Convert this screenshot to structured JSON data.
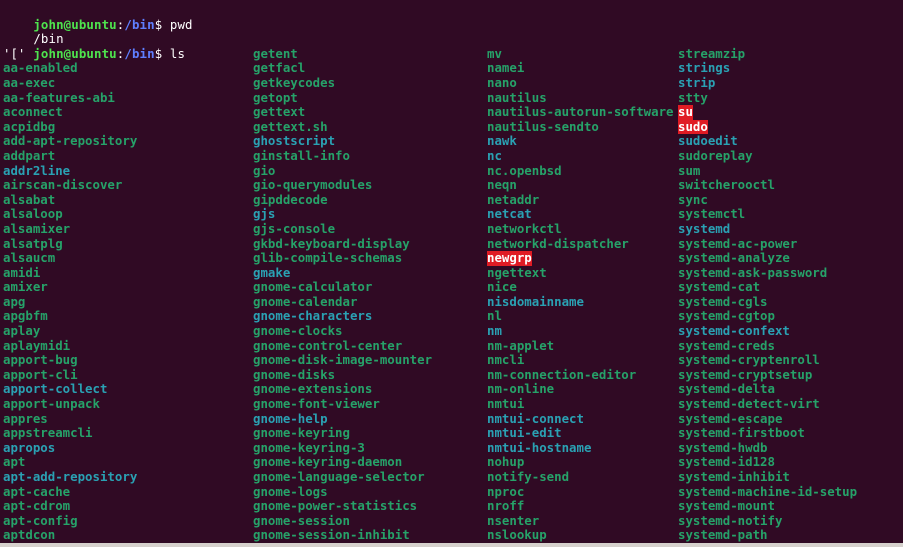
{
  "terminal": {
    "theme": {
      "background": "#300a24",
      "foreground": "#ffffff",
      "exec_color": "#26a269",
      "link_color": "#2aa1b3",
      "setuid_bg": "#e01b24",
      "prompt_user_color": "#4ee44e",
      "prompt_path_color": "#5f7fff"
    },
    "prompt": {
      "user_host": "john@ubuntu",
      "colon": ":",
      "path": "/bin",
      "sigil": "$"
    },
    "history": [
      {
        "type": "prompt",
        "command": " pwd"
      },
      {
        "type": "output",
        "text": "/bin"
      },
      {
        "type": "prompt",
        "command": " ls"
      }
    ],
    "ls": {
      "columns": 4,
      "rows": 34,
      "entries": [
        [
          {
            "name": "'['",
            "style": "plain"
          },
          {
            "name": "getent",
            "style": "exec"
          },
          {
            "name": "mv",
            "style": "exec"
          },
          {
            "name": "streamzip",
            "style": "exec"
          }
        ],
        [
          {
            "name": "aa-enabled",
            "style": "exec"
          },
          {
            "name": "getfacl",
            "style": "exec"
          },
          {
            "name": "namei",
            "style": "exec"
          },
          {
            "name": "strings",
            "style": "link"
          }
        ],
        [
          {
            "name": "aa-exec",
            "style": "exec"
          },
          {
            "name": "getkeycodes",
            "style": "exec"
          },
          {
            "name": "nano",
            "style": "exec"
          },
          {
            "name": "strip",
            "style": "link"
          }
        ],
        [
          {
            "name": "aa-features-abi",
            "style": "exec"
          },
          {
            "name": "getopt",
            "style": "exec"
          },
          {
            "name": "nautilus",
            "style": "exec"
          },
          {
            "name": "stty",
            "style": "exec"
          }
        ],
        [
          {
            "name": "aconnect",
            "style": "exec"
          },
          {
            "name": "gettext",
            "style": "exec"
          },
          {
            "name": "nautilus-autorun-software",
            "style": "exec"
          },
          {
            "name": "su",
            "style": "setuid"
          }
        ],
        [
          {
            "name": "acpidbg",
            "style": "exec"
          },
          {
            "name": "gettext.sh",
            "style": "exec"
          },
          {
            "name": "nautilus-sendto",
            "style": "exec"
          },
          {
            "name": "sudo",
            "style": "setuid"
          }
        ],
        [
          {
            "name": "add-apt-repository",
            "style": "exec"
          },
          {
            "name": "ghostscript",
            "style": "link"
          },
          {
            "name": "nawk",
            "style": "link"
          },
          {
            "name": "sudoedit",
            "style": "link"
          }
        ],
        [
          {
            "name": "addpart",
            "style": "exec"
          },
          {
            "name": "ginstall-info",
            "style": "exec"
          },
          {
            "name": "nc",
            "style": "link"
          },
          {
            "name": "sudoreplay",
            "style": "exec"
          }
        ],
        [
          {
            "name": "addr2line",
            "style": "link"
          },
          {
            "name": "gio",
            "style": "exec"
          },
          {
            "name": "nc.openbsd",
            "style": "exec"
          },
          {
            "name": "sum",
            "style": "exec"
          }
        ],
        [
          {
            "name": "airscan-discover",
            "style": "exec"
          },
          {
            "name": "gio-querymodules",
            "style": "exec"
          },
          {
            "name": "neqn",
            "style": "exec"
          },
          {
            "name": "switcherooctl",
            "style": "exec"
          }
        ],
        [
          {
            "name": "alsabat",
            "style": "exec"
          },
          {
            "name": "gipddecode",
            "style": "exec"
          },
          {
            "name": "netaddr",
            "style": "exec"
          },
          {
            "name": "sync",
            "style": "exec"
          }
        ],
        [
          {
            "name": "alsaloop",
            "style": "exec"
          },
          {
            "name": "gjs",
            "style": "link"
          },
          {
            "name": "netcat",
            "style": "link"
          },
          {
            "name": "systemctl",
            "style": "exec"
          }
        ],
        [
          {
            "name": "alsamixer",
            "style": "exec"
          },
          {
            "name": "gjs-console",
            "style": "exec"
          },
          {
            "name": "networkctl",
            "style": "exec"
          },
          {
            "name": "systemd",
            "style": "link"
          }
        ],
        [
          {
            "name": "alsatplg",
            "style": "exec"
          },
          {
            "name": "gkbd-keyboard-display",
            "style": "exec"
          },
          {
            "name": "networkd-dispatcher",
            "style": "exec"
          },
          {
            "name": "systemd-ac-power",
            "style": "exec"
          }
        ],
        [
          {
            "name": "alsaucm",
            "style": "exec"
          },
          {
            "name": "glib-compile-schemas",
            "style": "exec"
          },
          {
            "name": "newgrp",
            "style": "setuid"
          },
          {
            "name": "systemd-analyze",
            "style": "exec"
          }
        ],
        [
          {
            "name": "amidi",
            "style": "exec"
          },
          {
            "name": "gmake",
            "style": "link"
          },
          {
            "name": "ngettext",
            "style": "exec"
          },
          {
            "name": "systemd-ask-password",
            "style": "exec"
          }
        ],
        [
          {
            "name": "amixer",
            "style": "exec"
          },
          {
            "name": "gnome-calculator",
            "style": "exec"
          },
          {
            "name": "nice",
            "style": "exec"
          },
          {
            "name": "systemd-cat",
            "style": "exec"
          }
        ],
        [
          {
            "name": "apg",
            "style": "exec"
          },
          {
            "name": "gnome-calendar",
            "style": "exec"
          },
          {
            "name": "nisdomainname",
            "style": "link"
          },
          {
            "name": "systemd-cgls",
            "style": "exec"
          }
        ],
        [
          {
            "name": "apgbfm",
            "style": "exec"
          },
          {
            "name": "gnome-characters",
            "style": "link"
          },
          {
            "name": "nl",
            "style": "exec"
          },
          {
            "name": "systemd-cgtop",
            "style": "exec"
          }
        ],
        [
          {
            "name": "aplay",
            "style": "exec"
          },
          {
            "name": "gnome-clocks",
            "style": "exec"
          },
          {
            "name": "nm",
            "style": "link"
          },
          {
            "name": "systemd-confext",
            "style": "link"
          }
        ],
        [
          {
            "name": "aplaymidi",
            "style": "exec"
          },
          {
            "name": "gnome-control-center",
            "style": "exec"
          },
          {
            "name": "nm-applet",
            "style": "exec"
          },
          {
            "name": "systemd-creds",
            "style": "exec"
          }
        ],
        [
          {
            "name": "apport-bug",
            "style": "exec"
          },
          {
            "name": "gnome-disk-image-mounter",
            "style": "exec"
          },
          {
            "name": "nmcli",
            "style": "exec"
          },
          {
            "name": "systemd-cryptenroll",
            "style": "exec"
          }
        ],
        [
          {
            "name": "apport-cli",
            "style": "exec"
          },
          {
            "name": "gnome-disks",
            "style": "exec"
          },
          {
            "name": "nm-connection-editor",
            "style": "exec"
          },
          {
            "name": "systemd-cryptsetup",
            "style": "exec"
          }
        ],
        [
          {
            "name": "apport-collect",
            "style": "link"
          },
          {
            "name": "gnome-extensions",
            "style": "exec"
          },
          {
            "name": "nm-online",
            "style": "exec"
          },
          {
            "name": "systemd-delta",
            "style": "exec"
          }
        ],
        [
          {
            "name": "apport-unpack",
            "style": "exec"
          },
          {
            "name": "gnome-font-viewer",
            "style": "exec"
          },
          {
            "name": "nmtui",
            "style": "exec"
          },
          {
            "name": "systemd-detect-virt",
            "style": "exec"
          }
        ],
        [
          {
            "name": "appres",
            "style": "exec"
          },
          {
            "name": "gnome-help",
            "style": "link"
          },
          {
            "name": "nmtui-connect",
            "style": "link"
          },
          {
            "name": "systemd-escape",
            "style": "exec"
          }
        ],
        [
          {
            "name": "appstreamcli",
            "style": "exec"
          },
          {
            "name": "gnome-keyring",
            "style": "exec"
          },
          {
            "name": "nmtui-edit",
            "style": "link"
          },
          {
            "name": "systemd-firstboot",
            "style": "exec"
          }
        ],
        [
          {
            "name": "apropos",
            "style": "link"
          },
          {
            "name": "gnome-keyring-3",
            "style": "exec"
          },
          {
            "name": "nmtui-hostname",
            "style": "link"
          },
          {
            "name": "systemd-hwdb",
            "style": "exec"
          }
        ],
        [
          {
            "name": "apt",
            "style": "exec"
          },
          {
            "name": "gnome-keyring-daemon",
            "style": "exec"
          },
          {
            "name": "nohup",
            "style": "exec"
          },
          {
            "name": "systemd-id128",
            "style": "exec"
          }
        ],
        [
          {
            "name": "apt-add-repository",
            "style": "link"
          },
          {
            "name": "gnome-language-selector",
            "style": "exec"
          },
          {
            "name": "notify-send",
            "style": "exec"
          },
          {
            "name": "systemd-inhibit",
            "style": "exec"
          }
        ],
        [
          {
            "name": "apt-cache",
            "style": "exec"
          },
          {
            "name": "gnome-logs",
            "style": "exec"
          },
          {
            "name": "nproc",
            "style": "exec"
          },
          {
            "name": "systemd-machine-id-setup",
            "style": "exec"
          }
        ],
        [
          {
            "name": "apt-cdrom",
            "style": "exec"
          },
          {
            "name": "gnome-power-statistics",
            "style": "exec"
          },
          {
            "name": "nroff",
            "style": "exec"
          },
          {
            "name": "systemd-mount",
            "style": "exec"
          }
        ],
        [
          {
            "name": "apt-config",
            "style": "exec"
          },
          {
            "name": "gnome-session",
            "style": "exec"
          },
          {
            "name": "nsenter",
            "style": "exec"
          },
          {
            "name": "systemd-notify",
            "style": "exec"
          }
        ],
        [
          {
            "name": "aptdcon",
            "style": "exec"
          },
          {
            "name": "gnome-session-inhibit",
            "style": "exec"
          },
          {
            "name": "nslookup",
            "style": "exec"
          },
          {
            "name": "systemd-path",
            "style": "exec"
          }
        ]
      ]
    }
  }
}
